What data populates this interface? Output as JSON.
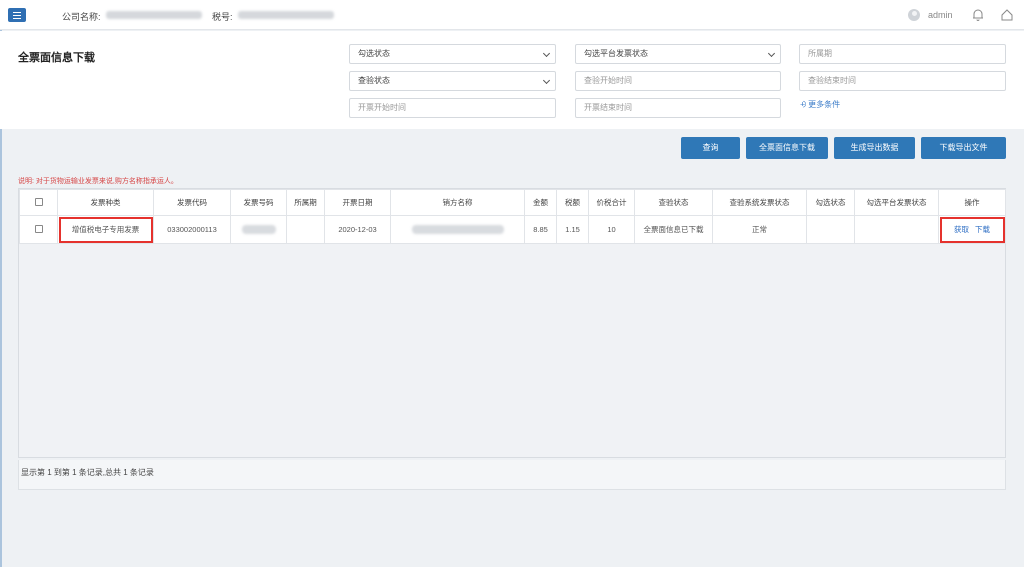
{
  "header": {
    "company_label": "公司名称:",
    "tax_label": "税号:",
    "user": "admin",
    "icons": [
      "menu-icon",
      "bell-icon",
      "home-icon"
    ]
  },
  "filters": {
    "title": "全票面信息下载",
    "check_status": "勾选状态",
    "platform_check_status": "勾选平台发票状态",
    "period_placeholder": "所属期",
    "verify_status": "查验状态",
    "verify_start_placeholder": "查验开始时间",
    "verify_end_placeholder": "查验结束时间",
    "issue_start_placeholder": "开票开始时间",
    "issue_end_placeholder": "开票结束时间",
    "more_label": "更多条件"
  },
  "actions": {
    "query": "查询",
    "download_full": "全票面信息下载",
    "generate_export": "生成导出数据",
    "download_export": "下载导出文件"
  },
  "note": "说明: 对于货物运输业发票来说,购方名称指承运人。",
  "table": {
    "columns": [
      "发票种类",
      "发票代码",
      "发票号码",
      "所属期",
      "开票日期",
      "销方名称",
      "金额",
      "税额",
      "价税合计",
      "查验状态",
      "查验系统发票状态",
      "勾选状态",
      "勾选平台发票状态",
      "操作"
    ],
    "rows": [
      {
        "type": "增值税电子专用发票",
        "code": "033002000113",
        "number": "",
        "period": "",
        "date": "2020-12-03",
        "seller": "",
        "amount": "8.85",
        "tax": "1.15",
        "total": "10",
        "verify_status": "全票面信息已下载",
        "system_status": "正常",
        "check_status": "",
        "platform_status": "",
        "op_fetch": "获取",
        "op_download": "下载"
      }
    ]
  },
  "footer": {
    "summary": "显示第 1 到第 1 条记录,总共 1 条记录"
  },
  "colors": {
    "primary": "#2f78b7",
    "highlight": "#e5322d",
    "note": "#d64545",
    "link": "#2f6fc4"
  }
}
